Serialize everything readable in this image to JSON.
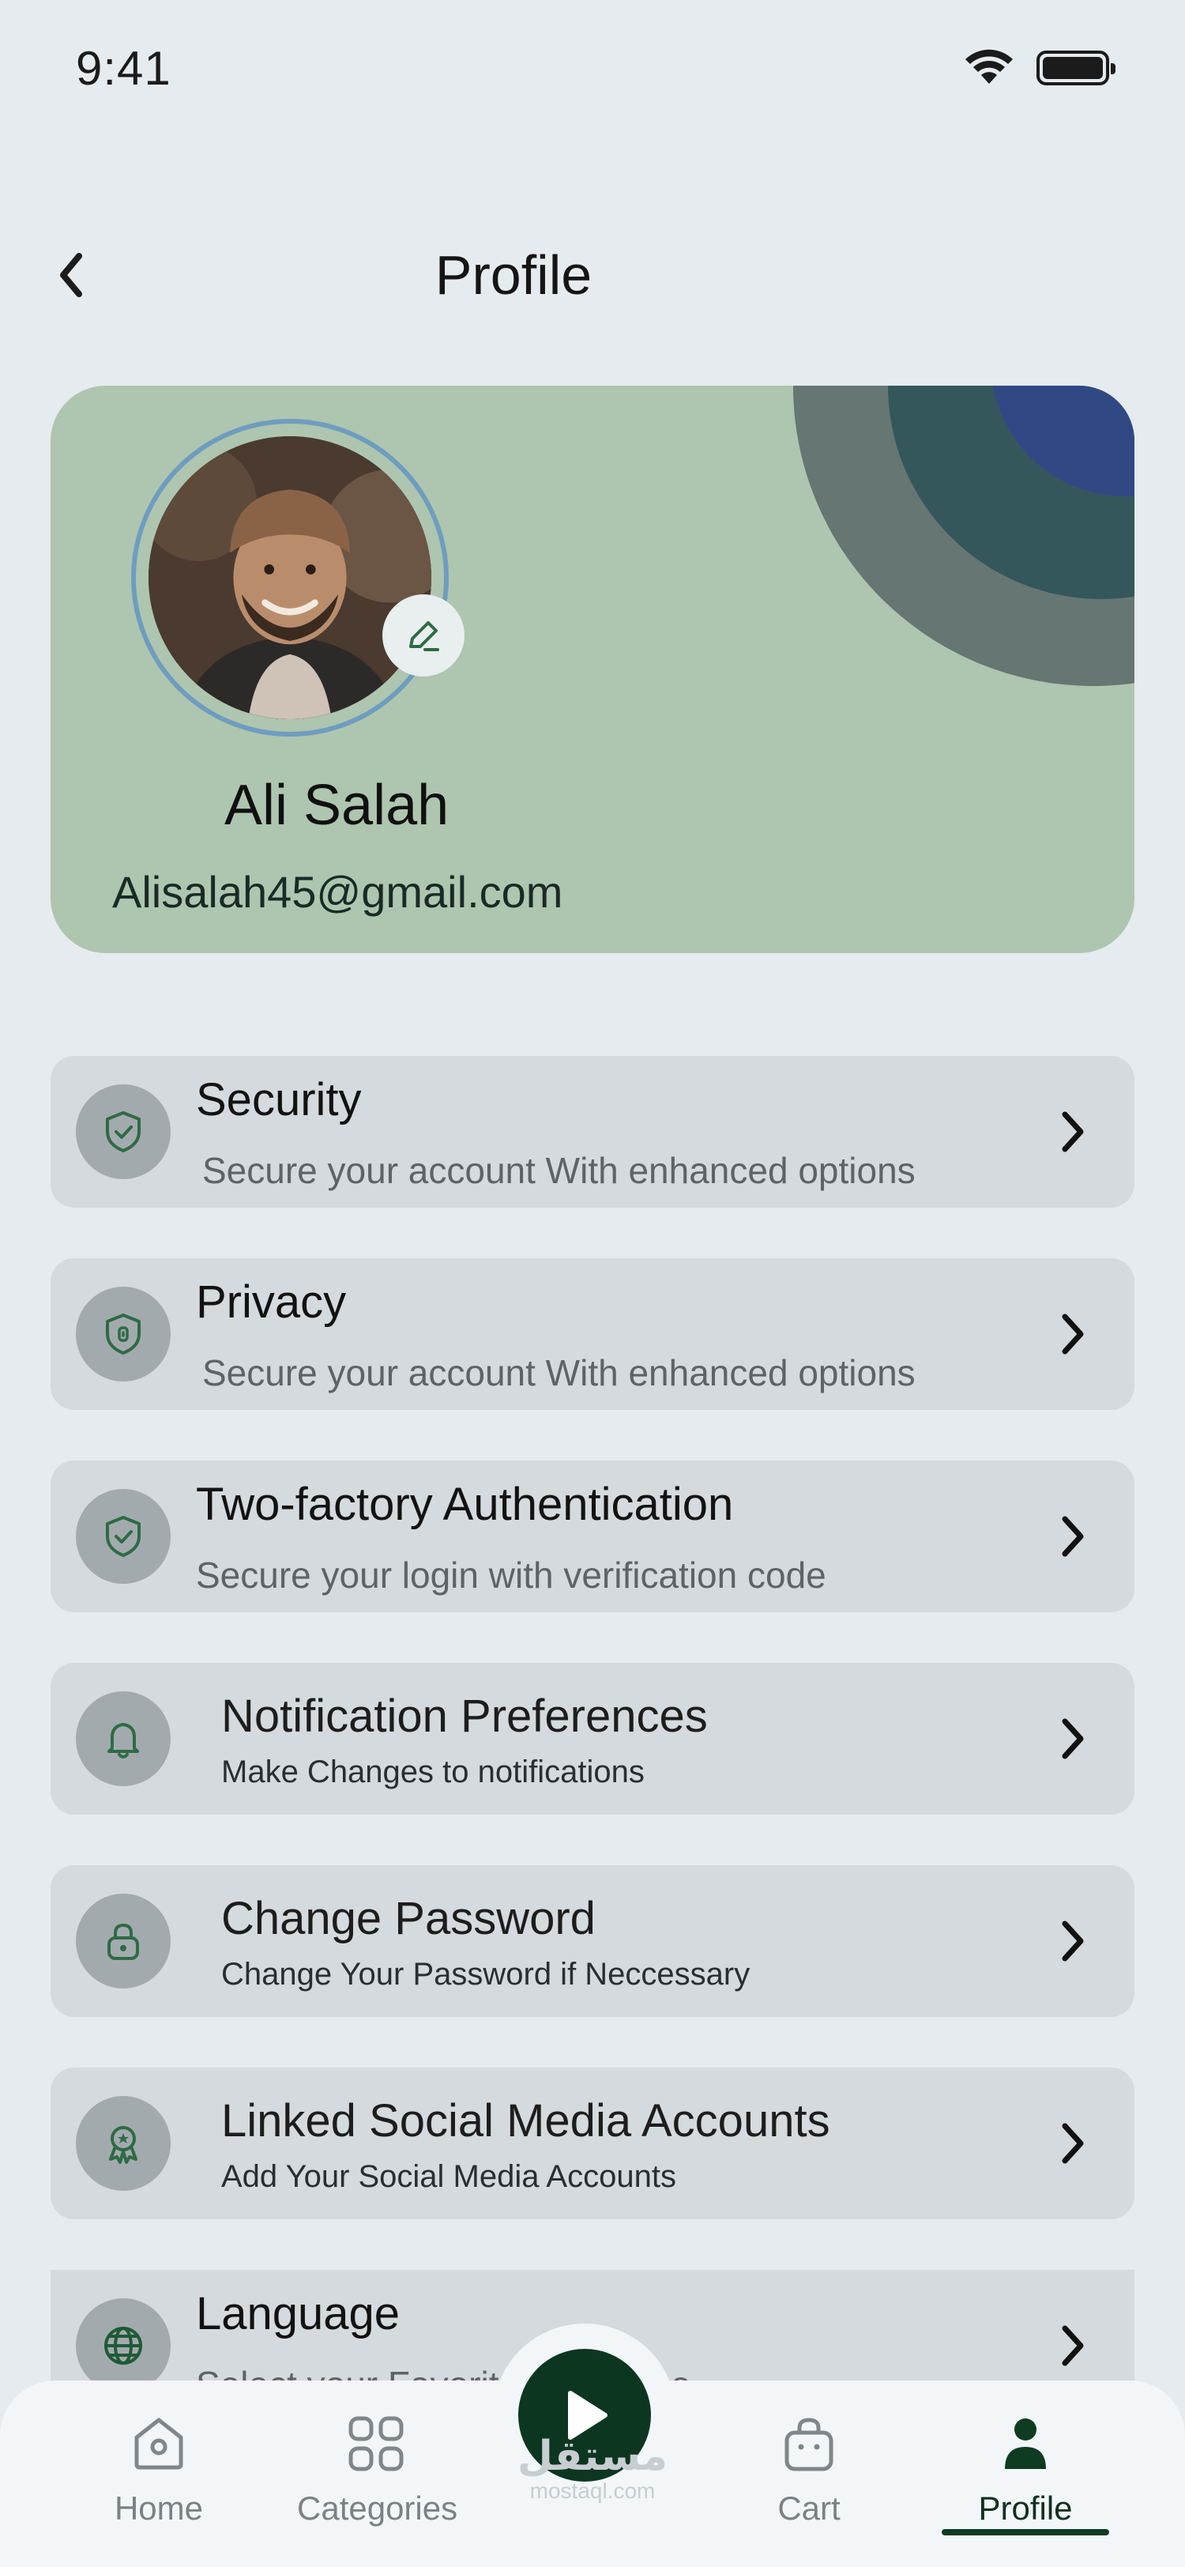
{
  "status_bar": {
    "time": "9:41"
  },
  "header": {
    "title": "Profile"
  },
  "profile": {
    "name": "Ali Salah",
    "email": "Alisalah45@gmail.com"
  },
  "settings": [
    {
      "title": "Security",
      "subtitle": "Secure your account With enhanced options",
      "icon": "shield-check-icon"
    },
    {
      "title": "Privacy",
      "subtitle": "Secure your account With enhanced options",
      "icon": "shield-lock-icon"
    },
    {
      "title": "Two-factory Authentication",
      "subtitle": "Secure your login with verification code",
      "icon": "shield-check-icon"
    },
    {
      "title": "Notification Preferences",
      "subtitle": "Make Changes to notifications",
      "icon": "bell-icon"
    },
    {
      "title": "Change Password",
      "subtitle": "Change Your Password if Neccessary",
      "icon": "lock-icon"
    },
    {
      "title": " Linked Social Media Accounts",
      "subtitle": "Add Your Social Media Accounts",
      "icon": "award-icon"
    },
    {
      "title": "Language",
      "subtitle": "Select your Favorite Language",
      "icon": "globe-icon"
    }
  ],
  "tabs": [
    {
      "label": "Home",
      "icon": "home-icon"
    },
    {
      "label": "Categories",
      "icon": "categories-icon"
    },
    {
      "label": "Cart",
      "icon": "bag-icon"
    },
    {
      "label": "Profile",
      "icon": "user-icon",
      "active": true
    }
  ],
  "watermark": {
    "arabic": "مستقل",
    "latin": "mostaql.com"
  },
  "colors": {
    "accent": "#0d3620",
    "card": "#aec5af",
    "item_bg": "#d4dadd",
    "icon_green": "#2e6b45"
  }
}
